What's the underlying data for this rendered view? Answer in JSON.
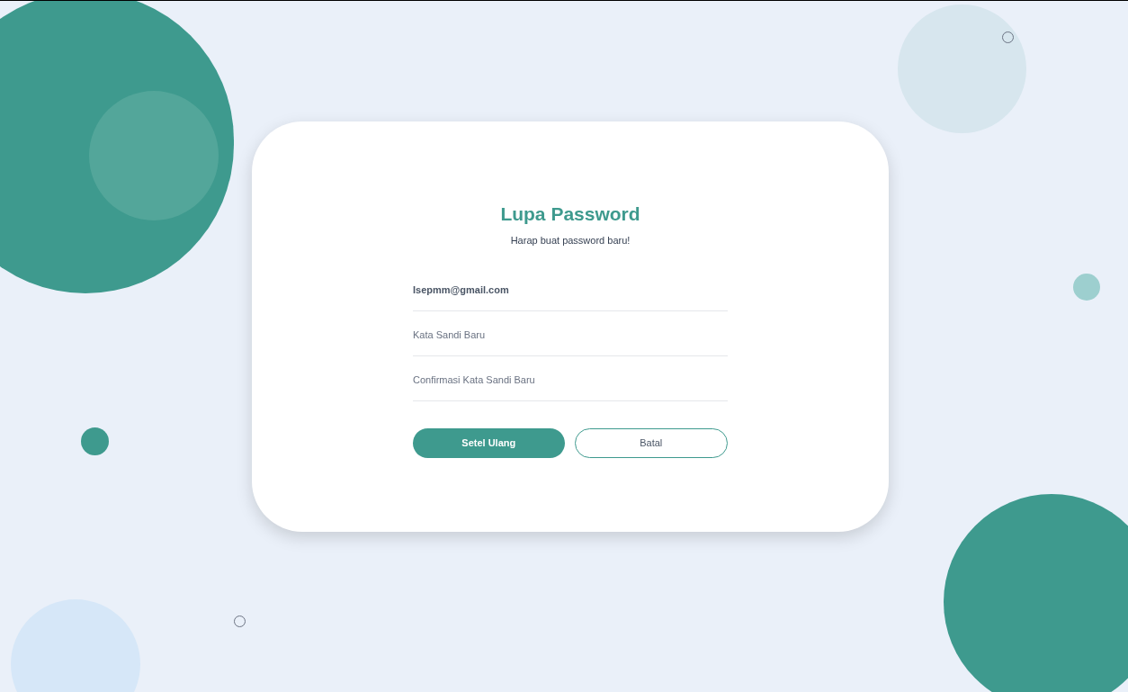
{
  "title": "Lupa Password",
  "subtitle": "Harap buat password baru!",
  "fields": [
    {
      "kind": "email",
      "value": "Isepmm@gmail.com"
    },
    {
      "kind": "password",
      "placeholder": "Kata Sandi Baru"
    },
    {
      "kind": "password",
      "placeholder": "Confirmasi Kata Sandi Baru"
    }
  ],
  "buttons": [
    {
      "kind": "primary",
      "label": "Setel Ulang"
    },
    {
      "kind": "secondary",
      "label": "Batal"
    }
  ]
}
